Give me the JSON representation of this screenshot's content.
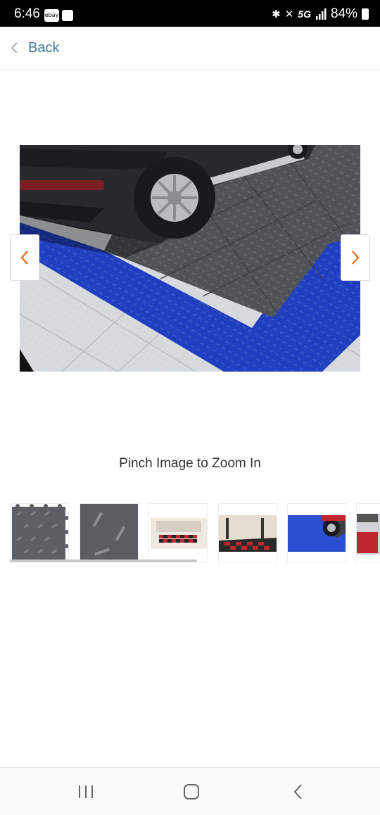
{
  "status_bar": {
    "time": "6:46",
    "ebay_badge": "ebay",
    "network": "5G",
    "battery": "84%"
  },
  "header": {
    "back_label": "Back",
    "icon": "chevron-left-icon"
  },
  "gallery": {
    "zoom_hint": "Pinch Image to Zoom In",
    "prev_icon": "chevron-left-icon",
    "next_icon": "chevron-right-icon",
    "accent_color": "#e07020"
  },
  "thumbnails": [
    {
      "name": "gray diamond tile"
    },
    {
      "name": "gray diamond tile close-up"
    },
    {
      "name": "garage checkered floor"
    },
    {
      "name": "garage with lift"
    },
    {
      "name": "blue tiles with car wheel"
    },
    {
      "name": "red and gray tiles"
    }
  ],
  "colors": {
    "link": "#3a78a0",
    "blue_tile": "#1f3fc0",
    "dark_tile": "#4f5256",
    "light_tile": "#d9dcdf"
  }
}
